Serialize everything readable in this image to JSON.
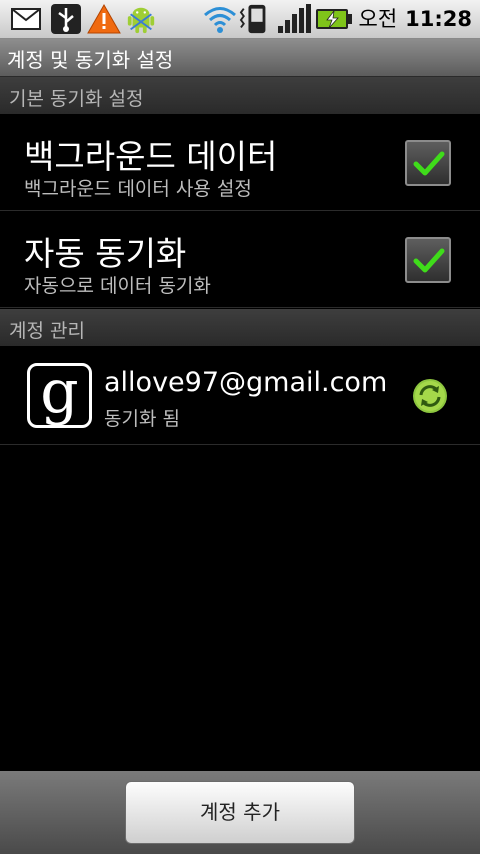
{
  "status_bar": {
    "icons": [
      "mail-icon",
      "usb-icon",
      "warning-icon",
      "android-debug-icon",
      "wifi-icon",
      "phone-vibrate-icon",
      "signal-icon",
      "battery-charging-icon"
    ],
    "ampm": "오전",
    "time": "11:28"
  },
  "title_bar": {
    "title": "계정 및 동기화 설정"
  },
  "sections": {
    "general": "기본 동기화 설정",
    "accounts": "계정 관리"
  },
  "settings": [
    {
      "title": "백그라운드 데이터",
      "summary": "백그라운드 데이터 사용 설정",
      "checked": true
    },
    {
      "title": "자동 동기화",
      "summary": "자동으로 데이터 동기화",
      "checked": true
    }
  ],
  "account": {
    "icon": "google-icon",
    "logo_letter": "g",
    "email": "allove97@gmail.com",
    "status": "동기화 됨",
    "sync_icon": "sync-icon"
  },
  "footer": {
    "add_account_label": "계정 추가"
  },
  "colors": {
    "check": "#3fdc1a",
    "sync": "#8dc63f"
  }
}
